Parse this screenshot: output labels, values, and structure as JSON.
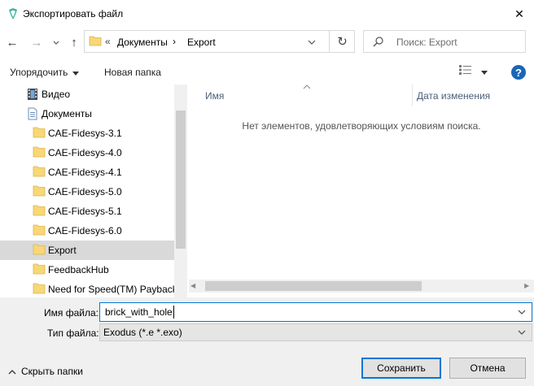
{
  "window": {
    "title": "Экспортировать файл",
    "close_symbol": "✕"
  },
  "nav": {
    "back_symbol": "←",
    "forward_symbol": "→",
    "recent_symbol": "⌄",
    "up_symbol": "↑"
  },
  "address": {
    "chevron": "«",
    "crumbs": [
      "Документы",
      "Export"
    ],
    "separator": "›",
    "refresh_symbol": "↻"
  },
  "search": {
    "placeholder": "Поиск: Export"
  },
  "toolbar": {
    "organize_label": "Упорядочить",
    "new_folder_label": "Новая папка",
    "help_symbol": "?"
  },
  "tree": [
    {
      "label": "Видео",
      "icon": "video-folder-icon"
    },
    {
      "label": "Документы",
      "icon": "documents-icon"
    },
    {
      "label": "CAE-Fidesys-3.1",
      "icon": "folder-icon"
    },
    {
      "label": "CAE-Fidesys-4.0",
      "icon": "folder-icon"
    },
    {
      "label": "CAE-Fidesys-4.1",
      "icon": "folder-icon"
    },
    {
      "label": "CAE-Fidesys-5.0",
      "icon": "folder-icon"
    },
    {
      "label": "CAE-Fidesys-5.1",
      "icon": "folder-icon"
    },
    {
      "label": "CAE-Fidesys-6.0",
      "icon": "folder-icon"
    },
    {
      "label": "Export",
      "icon": "folder-icon",
      "selected": true
    },
    {
      "label": "FeedbackHub",
      "icon": "folder-icon"
    },
    {
      "label": "Need for Speed(TM) Payback",
      "icon": "folder-icon"
    }
  ],
  "content": {
    "col_name": "Имя",
    "col_date": "Дата изменения",
    "empty_message": "Нет элементов, удовлетворяющих условиям поиска."
  },
  "form": {
    "filename_label": "Имя файла:",
    "filename_value": "brick_with_hole",
    "filetype_label": "Тип файла:",
    "filetype_value": "Exodus (*.e *.exo)"
  },
  "footer": {
    "hide_folders_label": "Скрыть папки",
    "save_label": "Сохранить",
    "cancel_label": "Отмена"
  },
  "colors": {
    "accent": "#0078d7",
    "selection": "#d9d9d9",
    "folder": "#f8d775",
    "help": "#1a66b8"
  }
}
